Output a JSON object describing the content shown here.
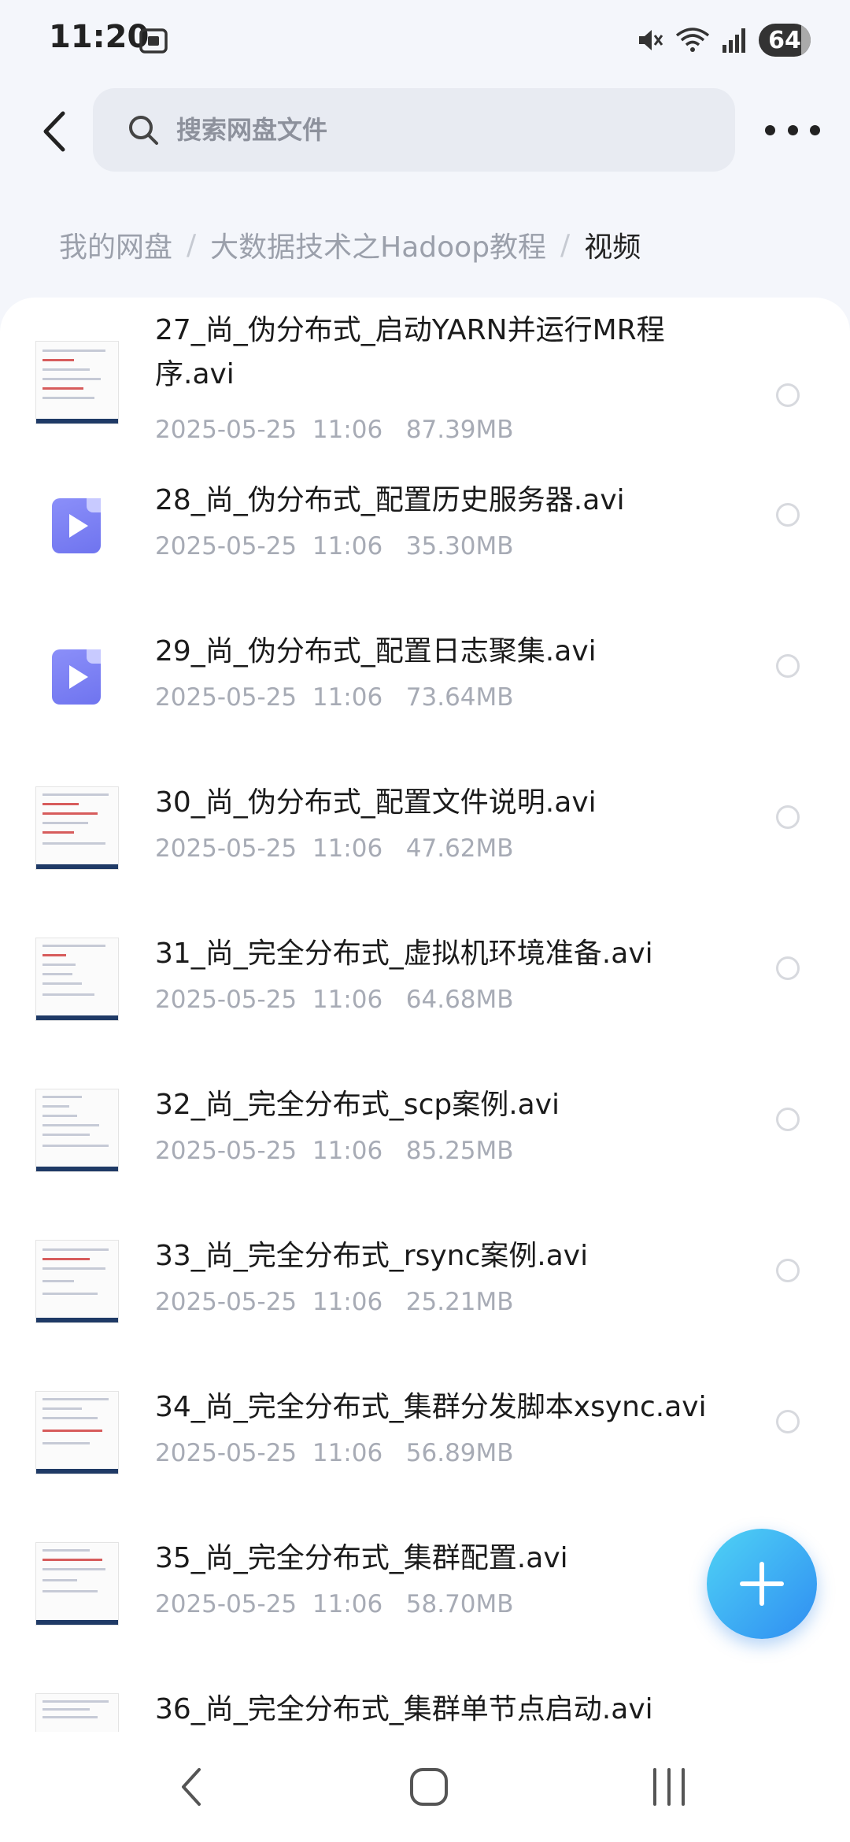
{
  "status_bar": {
    "time": "11:20",
    "battery": "64",
    "icons": [
      "screenshot-icon",
      "mute-icon",
      "wifi-icon",
      "signal-icon"
    ]
  },
  "search": {
    "placeholder": "搜索网盘文件"
  },
  "breadcrumb": {
    "items": [
      "我的网盘",
      "大数据技术之Hadoop教程",
      "视频"
    ],
    "separator": "/"
  },
  "files": [
    {
      "name": "27_尚_伪分布式_启动YARN并运行MR程序.avi",
      "date": "2025-05-25  11:06",
      "size": "87.39MB",
      "thumb": "document"
    },
    {
      "name": "28_尚_伪分布式_配置历史服务器.avi",
      "date": "2025-05-25  11:06",
      "size": "35.30MB",
      "thumb": "video-icon"
    },
    {
      "name": "29_尚_伪分布式_配置日志聚集.avi",
      "date": "2025-05-25  11:06",
      "size": "73.64MB",
      "thumb": "video-icon"
    },
    {
      "name": "30_尚_伪分布式_配置文件说明.avi",
      "date": "2025-05-25  11:06",
      "size": "47.62MB",
      "thumb": "document"
    },
    {
      "name": "31_尚_完全分布式_虚拟机环境准备.avi",
      "date": "2025-05-25  11:06",
      "size": "64.68MB",
      "thumb": "document"
    },
    {
      "name": "32_尚_完全分布式_scp案例.avi",
      "date": "2025-05-25  11:06",
      "size": "85.25MB",
      "thumb": "document"
    },
    {
      "name": "33_尚_完全分布式_rsync案例.avi",
      "date": "2025-05-25  11:06",
      "size": "25.21MB",
      "thumb": "document"
    },
    {
      "name": "34_尚_完全分布式_集群分发脚本xsync.avi",
      "date": "2025-05-25  11:06",
      "size": "56.89MB",
      "thumb": "document"
    },
    {
      "name": "35_尚_完全分布式_集群配置.avi",
      "date": "2025-05-25  11:06",
      "size": "58.70MB",
      "thumb": "document"
    },
    {
      "name": "36_尚_完全分布式_集群单节点启动.avi",
      "date": "",
      "size": "",
      "thumb": "document"
    }
  ],
  "colors": {
    "accent": "#2f8df2",
    "video_icon": "#7b80f5",
    "background": "#f4f6fb"
  }
}
